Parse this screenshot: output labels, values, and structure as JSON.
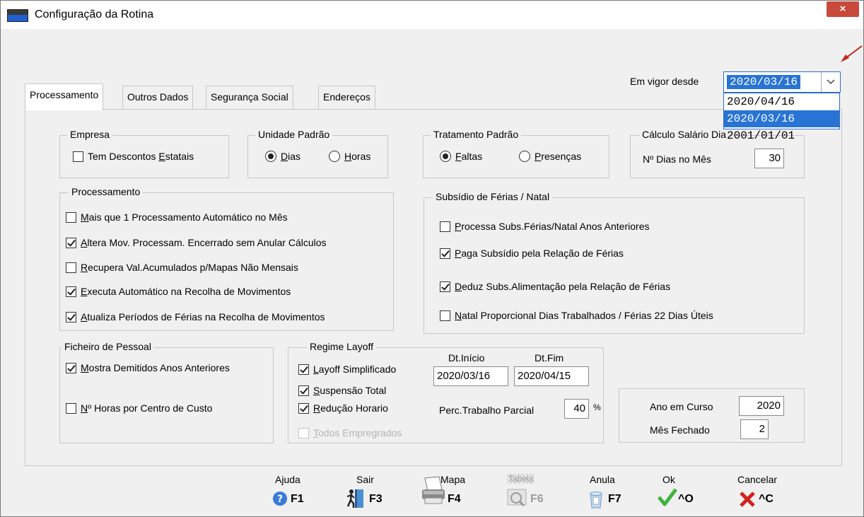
{
  "window": {
    "title": "Configuração da Rotina",
    "close": "×"
  },
  "vigor": {
    "label": "Em vigor desde",
    "value": "2020/03/16",
    "options": [
      "2020/04/16",
      "2020/03/16",
      "2001/01/01"
    ]
  },
  "tabs": [
    "Processamento",
    "Outros Dados",
    "Segurança Social",
    "Endereços"
  ],
  "empresa": {
    "title": "Empresa",
    "pre": "Tem Descontos ",
    "u": "E",
    "post": "statais",
    "checked": false
  },
  "unidade": {
    "title": "Unidade Padrão",
    "dias_u": "D",
    "dias_rest": "ias",
    "horas_u": "H",
    "horas_rest": "oras",
    "selected": "Dias"
  },
  "tratamento": {
    "title": "Tratamento Padrão",
    "faltas_u": "F",
    "faltas_rest": "altas",
    "presencas_u": "P",
    "presencas_rest": "resenças",
    "selected": "Faltas"
  },
  "calculo": {
    "title": "Cálculo Salário Dia",
    "label": "Nº Dias no Mês",
    "value": "30"
  },
  "processamento": {
    "title": "Processamento",
    "items": [
      {
        "u": "M",
        "rest": "ais que 1 Processamento Automático no Mês",
        "checked": false
      },
      {
        "u": "A",
        "rest": "ltera Mov. Processam. Encerrado sem Anular Cálculos",
        "checked": true
      },
      {
        "u": "R",
        "rest": "ecupera Val.Acumulados  p/Mapas Não Mensais",
        "checked": false
      },
      {
        "u": "E",
        "rest": "xecuta Automático na Recolha de Movimentos",
        "checked": true
      },
      {
        "u": "A",
        "rest": "tualiza Períodos de Férias na Recolha de Movimentos",
        "checked": true
      }
    ]
  },
  "subsidio": {
    "title": "Subsídio de Férias / Natal",
    "items": [
      {
        "u": "P",
        "rest": "rocessa Subs.Férias/Natal Anos Anteriores",
        "checked": false
      },
      {
        "u": "P",
        "rest": "aga Subsídio pela Relação de Férias",
        "checked": true
      },
      {
        "u": "D",
        "rest": "eduz Subs.Alimentação pela Relação de Férias",
        "checked": true
      },
      {
        "u": "N",
        "rest": "atal Proporcional  Dias Trabalhados / Férias 22 Dias Úteis",
        "checked": false
      }
    ]
  },
  "ficheiro": {
    "title": "Ficheiro de Pessoal",
    "items": [
      {
        "u": "M",
        "rest": "ostra Demitidos Anos Anteriores",
        "checked": true
      },
      {
        "u": "N",
        "rest": "º Horas por Centro de Custo",
        "checked": false
      }
    ]
  },
  "layoff": {
    "title": "Regime Layoff",
    "items": [
      {
        "u": "L",
        "rest": "ayoff Simplificado",
        "checked": true
      },
      {
        "u": "S",
        "rest": "uspensão Total",
        "checked": true
      },
      {
        "u": "R",
        "rest": "edução Horario",
        "checked": true
      },
      {
        "u": "T",
        "rest": "odos Empregrados",
        "checked": false
      }
    ],
    "dt_inicio_label": "Dt.Início",
    "dt_fim_label": "Dt.Fim",
    "dt_inicio": "2020/03/16",
    "dt_fim": "2020/04/15",
    "perc_label": "Perc.Trabalho Parcial",
    "perc_value": "40",
    "perc_unit": "%"
  },
  "ano": {
    "label": "Ano em Curso",
    "value": "2020",
    "mes_label": "Mês Fechado",
    "mes_value": "2"
  },
  "buttons": [
    {
      "label": "Ajuda",
      "key": "F1"
    },
    {
      "label": "Sair",
      "key": "F3"
    },
    {
      "label": "Mapa",
      "key": "F4"
    },
    {
      "label": "Tabela",
      "key": "F6"
    },
    {
      "label": "Anula",
      "key": "F7"
    },
    {
      "label": "Ok",
      "key": "^O"
    },
    {
      "label": "Cancelar",
      "key": "^C"
    }
  ],
  "colors": {
    "accent": "#2874d4",
    "ok": "#3cb43c",
    "cancel": "#d42020",
    "arrow": "#c0281e"
  }
}
